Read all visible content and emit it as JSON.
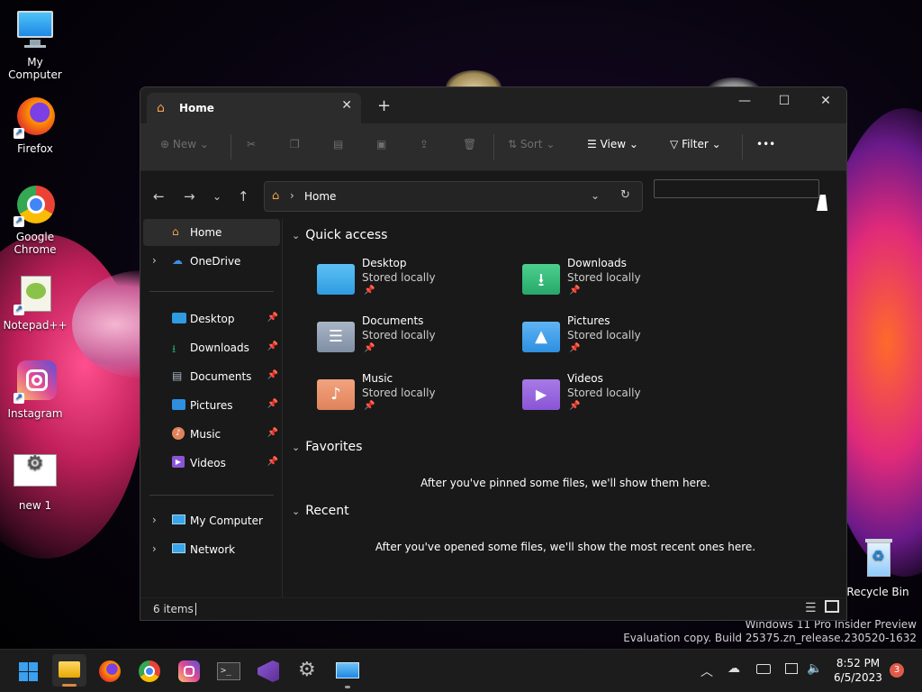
{
  "desktop": {
    "icons": [
      {
        "label": "My Computer"
      },
      {
        "label": "Firefox"
      },
      {
        "label": "Google Chrome"
      },
      {
        "label": "Notepad++"
      },
      {
        "label": "Instagram"
      },
      {
        "label": "new 1"
      },
      {
        "label": "Recycle Bin"
      }
    ],
    "watermark": {
      "line1": "Windows 11 Pro Insider Preview",
      "line2": "Evaluation copy. Build 25375.zn_release.230520-1632"
    }
  },
  "window": {
    "tab": {
      "title": "Home",
      "close": "✕"
    },
    "new_tab": "+",
    "controls": {
      "minimize": "—",
      "maximize": "☐",
      "close": "✕"
    },
    "toolbar": {
      "new": "New",
      "sort": "Sort",
      "view": "View",
      "filter": "Filter",
      "more": "•••"
    },
    "address": {
      "location": "Home"
    },
    "search": {
      "placeholder": ""
    },
    "nav": {
      "items": [
        {
          "label": "Home"
        },
        {
          "label": "OneDrive"
        }
      ],
      "pinned": [
        {
          "label": "Desktop"
        },
        {
          "label": "Downloads"
        },
        {
          "label": "Documents"
        },
        {
          "label": "Pictures"
        },
        {
          "label": "Music"
        },
        {
          "label": "Videos"
        }
      ],
      "devices": [
        {
          "label": "My Computer"
        },
        {
          "label": "Network"
        }
      ]
    },
    "quick_access": {
      "heading": "Quick access",
      "folders": [
        {
          "name": "Desktop",
          "sub": "Stored locally",
          "color": "#2f9be0"
        },
        {
          "name": "Downloads",
          "sub": "Stored locally",
          "color": "#27a86a"
        },
        {
          "name": "Documents",
          "sub": "Stored locally",
          "color": "#7f8ea3"
        },
        {
          "name": "Pictures",
          "sub": "Stored locally",
          "color": "#2e8fe0"
        },
        {
          "name": "Music",
          "sub": "Stored locally",
          "color": "#e0835b"
        },
        {
          "name": "Videos",
          "sub": "Stored locally",
          "color": "#8a55d6"
        }
      ]
    },
    "favorites": {
      "heading": "Favorites",
      "empty": "After you've pinned some files, we'll show them here."
    },
    "recent": {
      "heading": "Recent",
      "empty": "After you've opened some files, we'll show the most recent ones here."
    },
    "status": {
      "items": "6 items"
    }
  },
  "taskbar": {
    "clock": {
      "time": "8:52 PM",
      "date": "6/5/2023"
    },
    "notifications": "3"
  }
}
